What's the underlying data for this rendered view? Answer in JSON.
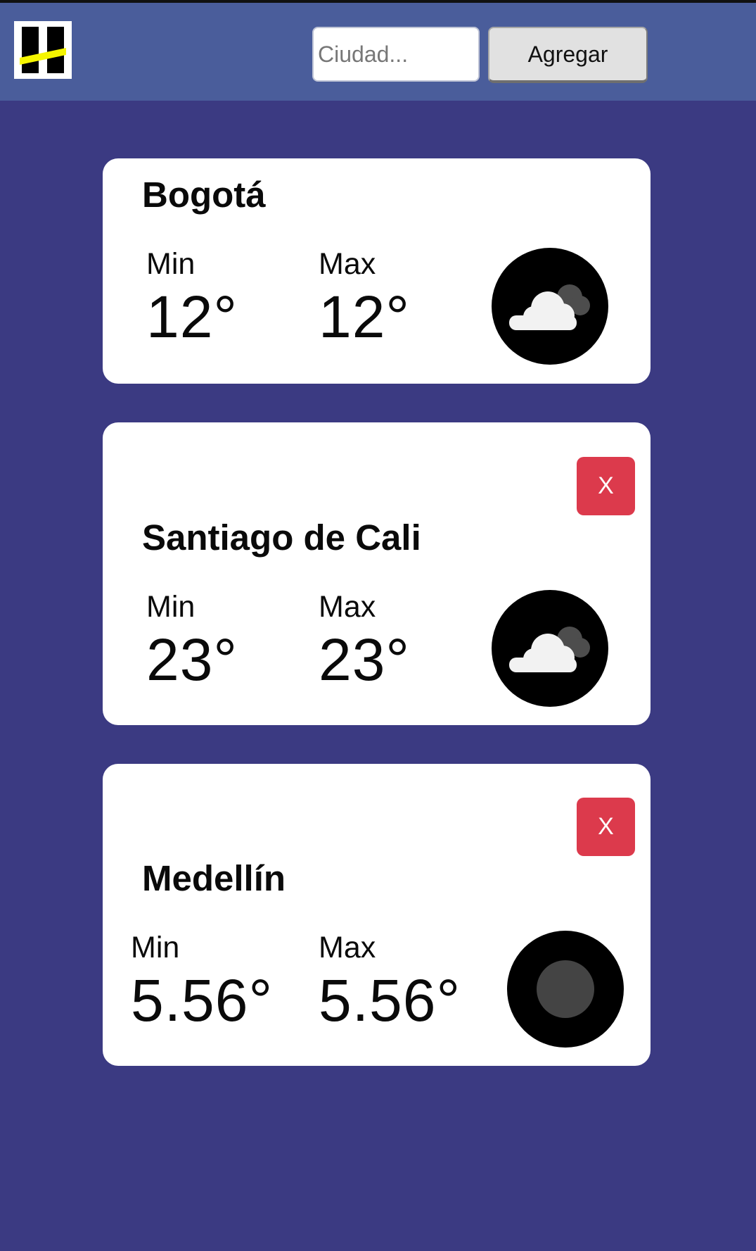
{
  "header": {
    "logo_icon": "logo-icon",
    "search": {
      "placeholder": "Ciudad...",
      "value": ""
    },
    "add_label": "Agregar"
  },
  "colors": {
    "background": "#3b3a82",
    "header": "#4a5d9b",
    "card": "#ffffff",
    "remove_button": "#dc3a4c",
    "logo_accent": "#f5f500"
  },
  "cities": [
    {
      "name": "Bogotá",
      "min_label": "Min",
      "min": "12°",
      "max_label": "Max",
      "max": "12°",
      "icon": "cloud-icon"
    },
    {
      "name": "Santiago de Cali",
      "min_label": "Min",
      "min": "23°",
      "max_label": "Max",
      "max": "23°",
      "icon": "cloud-icon",
      "remove_label": "X"
    },
    {
      "name": "Medellín",
      "min_label": "Min",
      "min": "5.56°",
      "max_label": "Max",
      "max": "5.56°",
      "icon": "circle-icon",
      "remove_label": "X"
    }
  ]
}
